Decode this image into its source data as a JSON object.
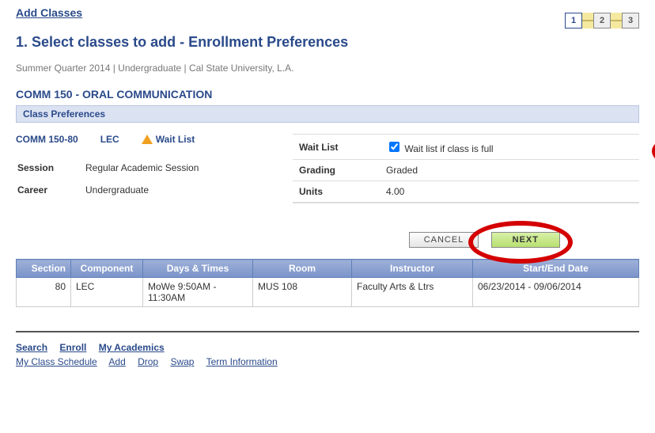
{
  "header": "Add Classes",
  "wizard": {
    "steps": [
      "1",
      "2",
      "3"
    ],
    "active": 0
  },
  "subtitle": "1.  Select classes to add - Enrollment Preferences",
  "context": "Summer Quarter 2014 | Undergraduate | Cal State University, L.A.",
  "course_title": "COMM  150 - ORAL COMMUNICATION",
  "section_bar": "Class Preferences",
  "class_info": {
    "code": "COMM  150-80",
    "component": "LEC",
    "status_label": "Wait List",
    "session_label": "Session",
    "session_value": "Regular Academic Session",
    "career_label": "Career",
    "career_value": "Undergraduate"
  },
  "prefs": {
    "waitlist_label": "Wait List",
    "waitlist_checkbox_text": "Wait list if class is full",
    "waitlist_checked": true,
    "grading_label": "Grading",
    "grading_value": "Graded",
    "units_label": "Units",
    "units_value": "4.00"
  },
  "buttons": {
    "cancel": "Cancel",
    "next": "Next"
  },
  "schedule": {
    "headers": [
      "Section",
      "Component",
      "Days & Times",
      "Room",
      "Instructor",
      "Start/End Date"
    ],
    "rows": [
      {
        "section": "80",
        "component": "LEC",
        "days": "MoWe 9:50AM - 11:30AM",
        "room": "MUS 108",
        "instructor": "Faculty Arts & Ltrs",
        "dates": "06/23/2014 - 09/06/2014"
      }
    ]
  },
  "footer_links_1": [
    "Search",
    "Enroll",
    "My Academics"
  ],
  "footer_links_2": [
    "My Class Schedule",
    "Add",
    "Drop",
    "Swap",
    "Term Information"
  ]
}
